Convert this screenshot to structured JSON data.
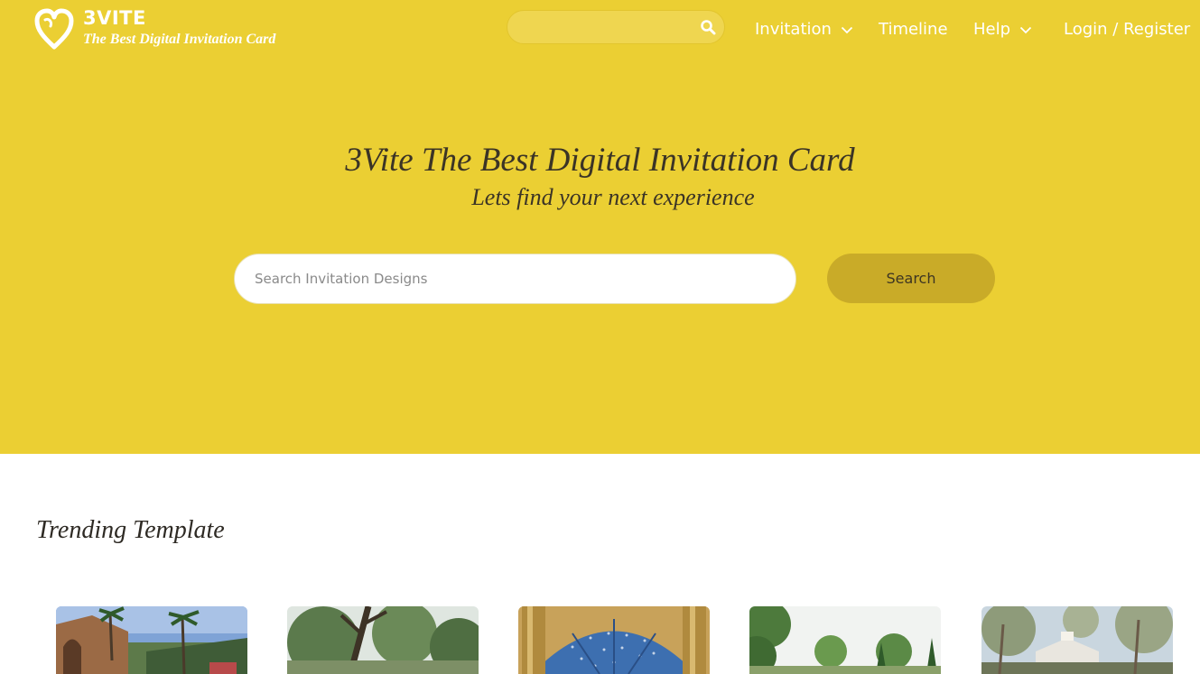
{
  "header": {
    "logo_name": "3VITE",
    "logo_tagline": "The Best Digital Invitation Card",
    "nav": {
      "invitation": "Invitation",
      "timeline": "Timeline",
      "help": "Help",
      "login": "Login / Register"
    }
  },
  "hero": {
    "title": "3Vite The Best Digital Invitation Card",
    "subtitle": "Lets find your next experience",
    "search_placeholder": "Search Invitation Designs",
    "search_button": "Search"
  },
  "trending": {
    "title": "Trending Template",
    "templates": [
      {
        "icon": "villa-palms-photo"
      },
      {
        "icon": "garden-tree-photo"
      },
      {
        "icon": "gazebo-dome-photo"
      },
      {
        "icon": "forest-garden-photo"
      },
      {
        "icon": "lodge-trees-photo"
      }
    ]
  },
  "colors": {
    "brand_yellow": "#ebcf33",
    "button_gold": "#c9ab28",
    "text_dark": "#3b3426"
  }
}
